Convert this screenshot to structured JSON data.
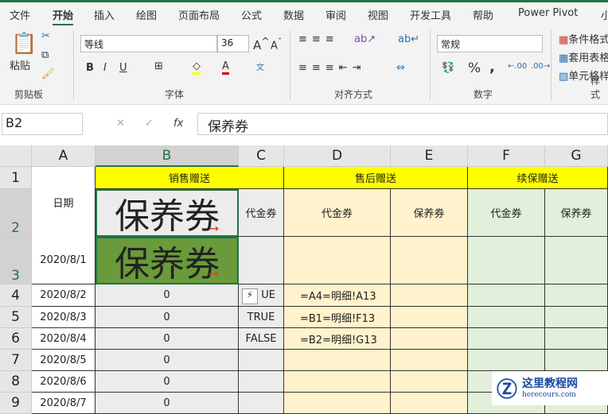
{
  "tabs": [
    "文件",
    "开始",
    "插入",
    "绘图",
    "页面布局",
    "公式",
    "数据",
    "审阅",
    "视图",
    "开发工具",
    "帮助",
    "Power Pivot",
    "小"
  ],
  "ribbon": {
    "paste": "粘贴",
    "clipboard": "剪贴板",
    "font_name": "等线",
    "font_size": "36",
    "font_group": "字体",
    "align_group": "对齐方式",
    "number_format": "常规",
    "number_group": "数字",
    "cond_format": "条件格式",
    "table_format": "套用表格",
    "cell_style": "单元格样",
    "styles_group": "样式",
    "bold": "B",
    "italic": "I",
    "underline": "U",
    "percent": "%",
    "comma": ","
  },
  "formula": {
    "name_box": "B2",
    "content": "保养券",
    "fx": "fx"
  },
  "columns": [
    "A",
    "B",
    "C",
    "D",
    "E",
    "F",
    "G"
  ],
  "rows": [
    "1",
    "2",
    "3",
    "4",
    "5",
    "6",
    "7",
    "8",
    "9"
  ],
  "cells": {
    "h_sales": "销售赠送",
    "h_after": "售后赠送",
    "h_renew": "续保赠送",
    "date": "日期",
    "c2": "代金券",
    "d2": "代金券",
    "e2": "保养券",
    "f2": "代金券",
    "g2": "保养券",
    "b2": "保养券",
    "b3": "保养券",
    "a3": "2020/8/1",
    "dates": [
      "2020/8/2",
      "2020/8/3",
      "2020/8/4",
      "2020/8/5",
      "2020/8/6",
      "2020/8/7"
    ],
    "bvals": [
      "0",
      "0",
      "0",
      "0",
      "0",
      "0"
    ],
    "cvals": [
      "UE",
      "TRUE",
      "FALSE",
      "",
      "",
      ""
    ],
    "dvals": [
      "=A4=明细!A13",
      "=B1=明细!F13",
      "=B2=明细!G13",
      "",
      "",
      ""
    ]
  },
  "watermark": {
    "name": "这里教程网",
    "url": "herecours.com"
  },
  "colors": {
    "accent": "#217346",
    "yellow": "#ffff00",
    "peach": "#fff2cc",
    "green": "#e2efda",
    "selected": "#6a9a3a"
  }
}
